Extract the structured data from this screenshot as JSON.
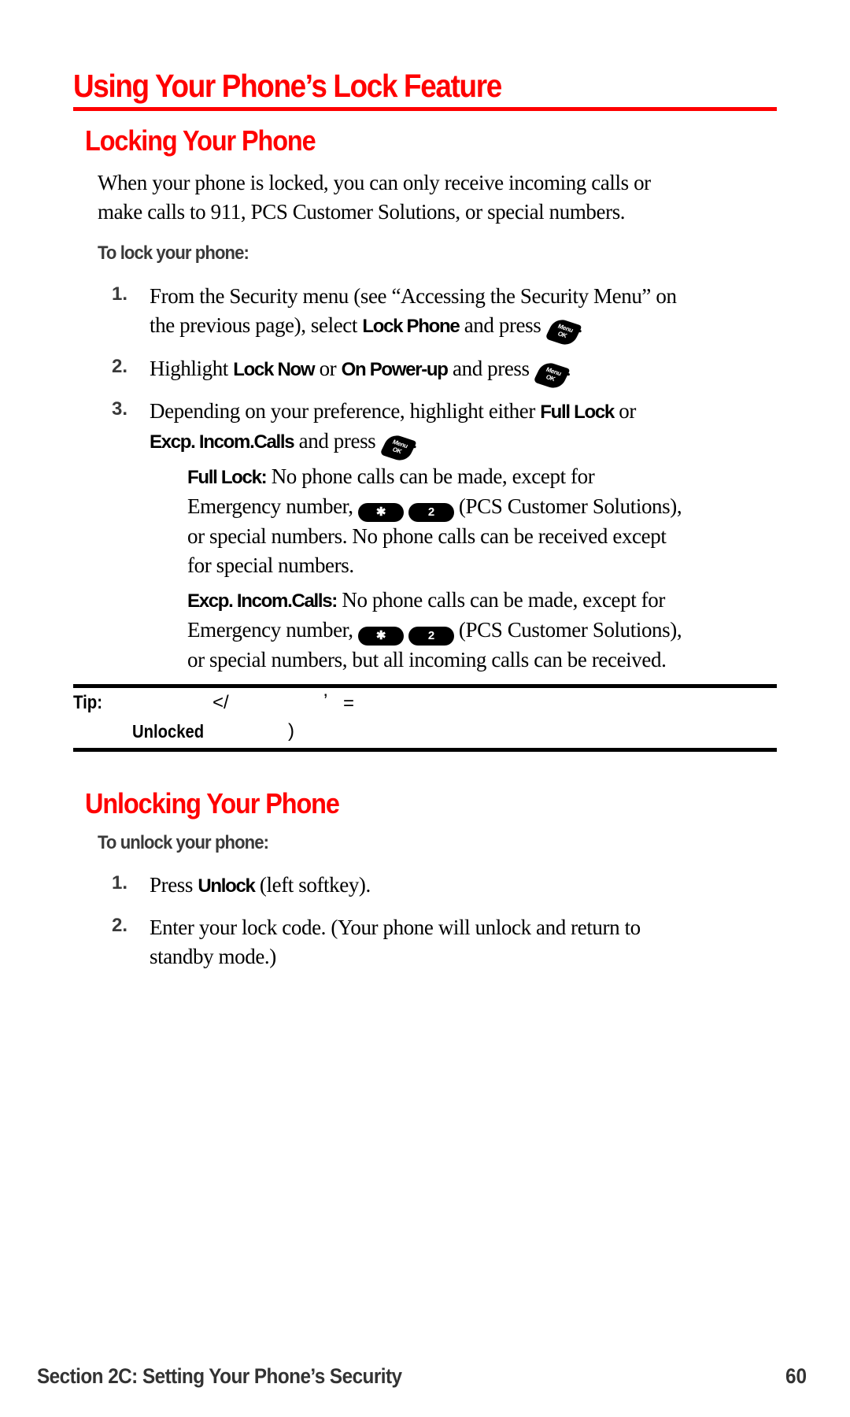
{
  "page": {
    "title": "Using Your Phone’s Lock Feature",
    "accent_color": "#ff0000"
  },
  "locking": {
    "heading": "Locking Your Phone",
    "intro": "When your phone is locked, you can only receive incoming calls or make calls to 911, PCS Customer Solutions, or special numbers.",
    "intro_lines": [
      "When your phone is locked, you can only receive incoming calls or",
      "make calls to 911, PCS Customer Solutions, or special numbers."
    ],
    "subheading": "To lock your phone:",
    "steps": [
      {
        "num": "1.",
        "line1": "From the Security menu (see “Accessing the Security Menu” on",
        "line2_pre": "the previous page), select ",
        "kw1": "Lock Phone",
        "line2_post": " and press ",
        "key_icon": "menu-ok-key",
        "end": "."
      },
      {
        "num": "2.",
        "pre": "Highlight ",
        "kw1": "Lock Now",
        "mid": " or ",
        "kw2": "On Power-up",
        "post": " and press ",
        "key_icon": "menu-ok-key",
        "end": "."
      },
      {
        "num": "3.",
        "line1_pre": "Depending on your preference, highlight either ",
        "kw1": "Full Lock",
        "line1_post": " or",
        "kw2": "Excp. Incom.Calls",
        "line2_post": " and press ",
        "key_icon": "menu-ok-key",
        "end": "."
      }
    ],
    "options": [
      {
        "label": "Full Lock:",
        "line1": " No phone calls can be made, except for",
        "line2_pre": "Emergency number, ",
        "keys": [
          "✱",
          "2"
        ],
        "line2_post": "(PCS Customer Solutions),",
        "line3": "or special numbers. No phone calls can be received except",
        "line4": "for special numbers."
      },
      {
        "label": "Excp. Incom.Calls:",
        "line1": " No phone calls can be made, except for",
        "line2_pre": "Emergency number, ",
        "keys": [
          "✱",
          "2"
        ],
        "line2_post": "(PCS Customer Solutions),",
        "line3": "or special numbers, but all incoming calls can be received."
      }
    ],
    "menu_key_label": "Menu OK"
  },
  "tip": {
    "label": "Tip:",
    "fragments": [
      "<",
      "/",
      "’",
      "="
    ],
    "unlocked": "Unlocked",
    "closing": ")"
  },
  "unlocking": {
    "heading": "Unlocking Your Phone",
    "subheading": "To unlock your phone:",
    "steps": [
      {
        "num": "1.",
        "pre": "Press ",
        "kw1": "Unlock",
        "post": " (left softkey)."
      },
      {
        "num": "2.",
        "line1": "Enter your lock code. (Your phone will unlock and return to",
        "line2": "standby mode.)"
      }
    ]
  },
  "footer": {
    "section": "Section 2C: Setting Your Phone’s Security",
    "page_number": "60"
  }
}
